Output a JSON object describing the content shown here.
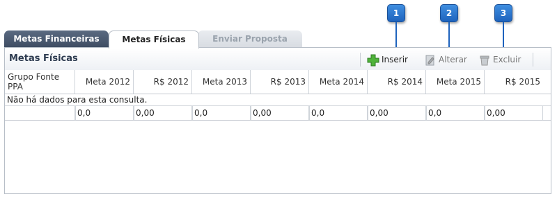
{
  "callouts": [
    "1",
    "2",
    "3"
  ],
  "tabs": [
    {
      "label": "Metas Financeiras"
    },
    {
      "label": "Metas Físicas"
    },
    {
      "label": "Enviar Proposta"
    }
  ],
  "panel": {
    "title": "Metas Físicas",
    "toolbar": {
      "insert_label": "Inserir",
      "edit_label": "Alterar",
      "delete_label": "Excluir"
    }
  },
  "grid": {
    "columns": [
      "Grupo Fonte PPA",
      "Meta 2012",
      "R$ 2012",
      "Meta 2013",
      "R$ 2013",
      "Meta 2014",
      "R$ 2014",
      "Meta 2015",
      "R$ 2015"
    ],
    "empty_message": "Não há dados para esta consulta.",
    "totals": [
      "",
      "0,0",
      "0,00",
      "0,0",
      "0,00",
      "0,0",
      "0,00",
      "0,0",
      "0,00"
    ]
  },
  "colors": {
    "accent": "#1e63bd",
    "tab_active_dark": "#4a5a70"
  }
}
